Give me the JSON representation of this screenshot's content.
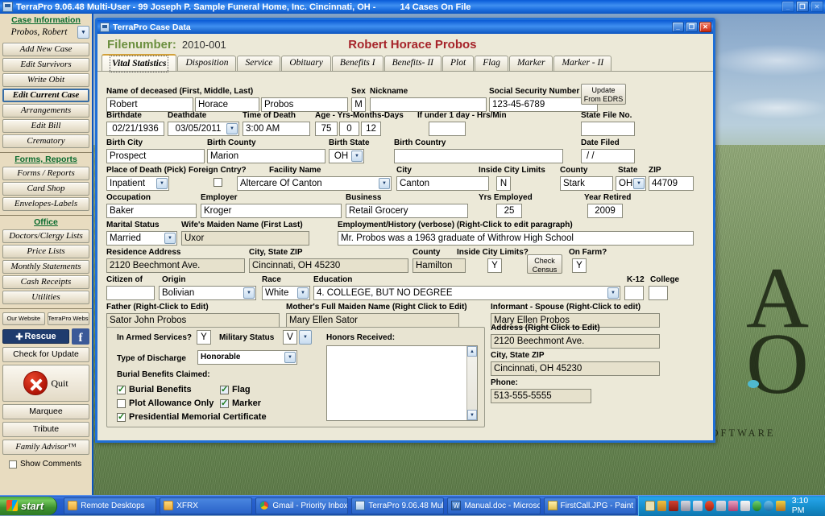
{
  "app": {
    "title_left": "TerraPro 9.06.48 Multi-User - 99 Joseph P. Sample Funeral Home, Inc. Cincinnati, OH -",
    "title_right": "14 Cases On File",
    "icon": "application-icon",
    "minimize": "_",
    "restore": "❐",
    "close": "✕"
  },
  "branding": {
    "watermark_letters": [
      "A",
      "O"
    ],
    "tagline": "PROFESSIONAL FUNERAL HOME SOFTWARE"
  },
  "sidebar": {
    "groups": [
      {
        "heading": "Case Information",
        "case_name": "Probos, Robert",
        "dropdown_icon": "chevron-down-icon",
        "buttons": [
          {
            "label": "Add New Case",
            "active": false
          },
          {
            "label": "Edit Survivors",
            "active": false
          },
          {
            "label": "Write Obit",
            "active": false
          },
          {
            "label": "Edit Current Case",
            "active": true
          },
          {
            "label": "Arrangements",
            "active": false
          },
          {
            "label": "Edit Bill",
            "active": false
          },
          {
            "label": "Crematory",
            "active": false
          }
        ]
      },
      {
        "heading": "Forms, Reports",
        "buttons": [
          {
            "label": "Forms / Reports",
            "active": false
          },
          {
            "label": "Card Shop",
            "active": false
          },
          {
            "label": "Envelopes-Labels",
            "active": false
          }
        ]
      },
      {
        "heading": "Office",
        "buttons": [
          {
            "label": "Doctors/Clergy Lists",
            "active": false
          },
          {
            "label": "Price Lists",
            "active": false
          },
          {
            "label": "Monthly Statements",
            "active": false
          },
          {
            "label": "Cash Receipts",
            "active": false
          },
          {
            "label": "Utilities",
            "active": false
          }
        ]
      }
    ],
    "website_buttons": [
      "Our Website",
      "TerraPro Website"
    ],
    "rescue_label": "Rescue",
    "rescue_icon": "rescue-cross-icon",
    "facebook_icon": "facebook-icon",
    "facebook_label": "f",
    "check_update": "Check for Update",
    "quit_label": "Quit",
    "quit_icon": "quit-x-icon",
    "bottom_buttons": [
      "Marquee",
      "Tribute",
      "Family Advisor™"
    ],
    "show_comments": "Show Comments",
    "show_comments_checked": false
  },
  "case_window": {
    "title": "TerraPro Case Data",
    "icon": "case-data-icon",
    "minimize": "_",
    "restore": "❐",
    "close": "✕",
    "filenumber_label": "Filenumber:",
    "filenumber_value": "2010-001",
    "deceased_display_name": "Robert Horace Probos",
    "tabs": [
      {
        "label": "Vital Statistics",
        "selected": true
      },
      {
        "label": "Disposition",
        "selected": false
      },
      {
        "label": "Service",
        "selected": false
      },
      {
        "label": "Obituary",
        "selected": false
      },
      {
        "label": "Benefits I",
        "selected": false
      },
      {
        "label": "Benefits- II",
        "selected": false
      },
      {
        "label": "Plot",
        "selected": false
      },
      {
        "label": "Flag",
        "selected": false
      },
      {
        "label": "Marker",
        "selected": false
      },
      {
        "label": "Marker - II",
        "selected": false
      }
    ]
  },
  "form": {
    "name_group_label": "Name of deceased (First, Middle, Last)",
    "first_name": "Robert",
    "middle_name": "Horace",
    "last_name": "Probos",
    "sex_label": "Sex",
    "sex": "M",
    "nickname_label": "Nickname",
    "nickname": "",
    "ssn_label": "Social Security Number",
    "ssn": "123-45-6789",
    "update_edrs_line1": "Update",
    "update_edrs_line2": "From EDRS",
    "birthdate_label": "Birthdate",
    "birthdate": "02/21/1936",
    "deathdate_label": "Deathdate",
    "deathdate": "03/05/2011",
    "time_of_death_label": "Time of Death",
    "time_of_death": "3:00 AM",
    "age_label": "Age - Yrs-Months-Days",
    "age_years": "75",
    "age_months": "0",
    "age_days": "12",
    "under_one_day_label": "If under 1 day - Hrs/Min",
    "under_one_day": "",
    "state_file_no_label": "State File No.",
    "state_file_no": "",
    "date_filed_label": "Date Filed",
    "date_filed": "/    /",
    "birth_city_label": "Birth City",
    "birth_city": "Prospect",
    "birth_county_label": "Birth County",
    "birth_county": "Marion",
    "birth_state_label": "Birth State",
    "birth_state": "OH",
    "birth_country_label": "Birth Country",
    "birth_country": "",
    "place_of_death_label": "Place of Death (Pick)",
    "place_of_death": "Inpatient",
    "foreign_cntry_label": "Foreign Cntry?",
    "foreign_cntry_checked": false,
    "facility_name_label": "Facility Name",
    "facility_name": "Altercare Of Canton",
    "city_label": "City",
    "city": "Canton",
    "inside_city_limits_label": "Inside City Limits",
    "inside_city_limits": "N",
    "county_label": "County",
    "county": "Stark",
    "state_label": "State",
    "state": "OH",
    "zip_label": "ZIP",
    "zip": "44709",
    "occupation_label": "Occupation",
    "occupation": "Baker",
    "employer_label": "Employer",
    "employer": "Kroger",
    "business_label": "Business",
    "business": "Retail Grocery",
    "yrs_employed_label": "Yrs Employed",
    "yrs_employed": "25",
    "year_retired_label": "Year Retired",
    "year_retired": "2009",
    "marital_status_label": "Marital Status",
    "marital_status": "Married",
    "wifes_maiden_label": "Wife's Maiden Name (First Last)",
    "wifes_maiden": "Uxor",
    "employment_history_label": "Employment/History (verbose) (Right-Click to edit paragraph)",
    "employment_history": "Mr. Probos was a 1963 graduate of Withrow High School",
    "residence_address_label": "Residence Address",
    "residence_address": "2120 Beechmont Ave.",
    "res_city_state_zip_label": "City, State ZIP",
    "res_city_state_zip": "Cincinnati, OH 45230",
    "res_county_label": "County",
    "res_county": "Hamilton",
    "res_inside_city_limits_label": "Inside City Limits?",
    "res_inside_city_limits": "Y",
    "check_census_line1": "Check",
    "check_census_line2": "Census",
    "on_farm_label": "On Farm?",
    "on_farm": "Y",
    "citizen_of_label": "Citizen of",
    "citizen_of": "",
    "origin_label": "Origin",
    "origin": "Bolivian",
    "race_label": "Race",
    "race": "White",
    "education_label": "Education",
    "education": "4. COLLEGE, BUT NO DEGREE",
    "k12_label": "K-12",
    "k12": "",
    "college_label": "College",
    "college": "",
    "father_label": "Father (Right-Click to Edit)",
    "father": "Sator John Probos",
    "mother_label": "Mother's Full Maiden Name (Right Click to Edit)",
    "mother": "Mary Ellen Sator",
    "informant_label": "Informant - Spouse (Right-Click to edit)",
    "informant": "Mary Ellen Probos",
    "informant_address_label": "Address  (Right Click to Edit)",
    "informant_address": "2120 Beechmont Ave.",
    "informant_city_state_zip_label": "City, State ZIP",
    "informant_city_state_zip": "Cincinnati, OH 45230",
    "informant_phone_label": "Phone:",
    "informant_phone": "513-555-5555",
    "armed_services_label": "In Armed Services?",
    "armed_services": "Y",
    "military_status_label": "Military Status",
    "military_status": "V",
    "type_of_discharge_label": "Type of Discharge",
    "type_of_discharge": "Honorable",
    "burial_benefits_claimed_label": "Burial Benefits Claimed:",
    "honors_received_label": "Honors Received:",
    "honors_received": "",
    "checkboxes": [
      {
        "label": "Burial Benefits",
        "checked": true
      },
      {
        "label": "Flag",
        "checked": true
      },
      {
        "label": "Plot Allowance Only",
        "checked": false
      },
      {
        "label": "Marker",
        "checked": true
      },
      {
        "label": "Presidential Memorial Certificate",
        "checked": true
      }
    ]
  },
  "taskbar": {
    "start_label": "start",
    "start_icon": "windows-flag-icon",
    "items": [
      {
        "label": "Remote Desktops",
        "icon": "folder-icon"
      },
      {
        "label": "XFRX",
        "icon": "folder-icon"
      },
      {
        "label": "Gmail - Priority Inbox ...",
        "icon": "chrome-icon"
      },
      {
        "label": "TerraPro 9.06.48 Mul...",
        "icon": "terrapro-icon"
      },
      {
        "label": "Manual.doc - Microso...",
        "icon": "word-icon"
      },
      {
        "label": "FirstCall.JPG - Paint",
        "icon": "paint-icon"
      }
    ],
    "tray_icons": [
      "mail-icon",
      "update-icon",
      "security-icon",
      "network-icon",
      "volume-icon",
      "shield-icon",
      "printer-icon",
      "monitor-icon",
      "antivirus-icon",
      "sync-icon",
      "clock-icon",
      "app-icon"
    ],
    "clock": "3:10 PM"
  },
  "colors": {
    "title_blue": "#0d55c0",
    "sidebar_tan": "#e8dcc0",
    "form_bg": "#ece9d8",
    "filenumber_green": "#6b8f3f",
    "deceased_red": "#a6242a",
    "heading_green": "#0a6b2e",
    "tab_accent": "#d2a13a"
  }
}
